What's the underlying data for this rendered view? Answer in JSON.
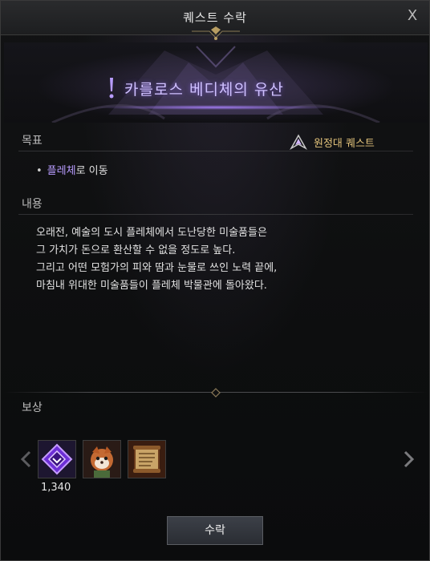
{
  "window": {
    "title": "퀘스트 수락",
    "close_glyph": "X"
  },
  "quest": {
    "title": "카를로스 베디체의 유산",
    "type_badge": "원정대 퀘스트"
  },
  "objective": {
    "label": "목표",
    "bullet": "•",
    "highlight": "플레체",
    "rest": "로 이동"
  },
  "details": {
    "label": "내용",
    "lines": [
      "오래전, 예술의 도시 플레체에서 도난당한 미술품들은",
      "그 가치가 돈으로 환산할 수 없을 정도로 높다.",
      "그리고 어떤 모험가의 피와 땀과 눈물로 쓰인 노력 끝에,",
      "마침내 위대한 미술품들이 플레체 박물관에 돌아왔다."
    ]
  },
  "rewards": {
    "label": "보상",
    "items": [
      {
        "icon": "purple-gem-icon",
        "count": "1,340"
      },
      {
        "icon": "red-panda-card-icon"
      },
      {
        "icon": "scroll-icon"
      }
    ]
  },
  "actions": {
    "accept_label": "수락"
  },
  "colors": {
    "accent_purple": "#b89cff",
    "badge_gold": "#e3c37b",
    "title_glow": "#cfc0ff"
  }
}
